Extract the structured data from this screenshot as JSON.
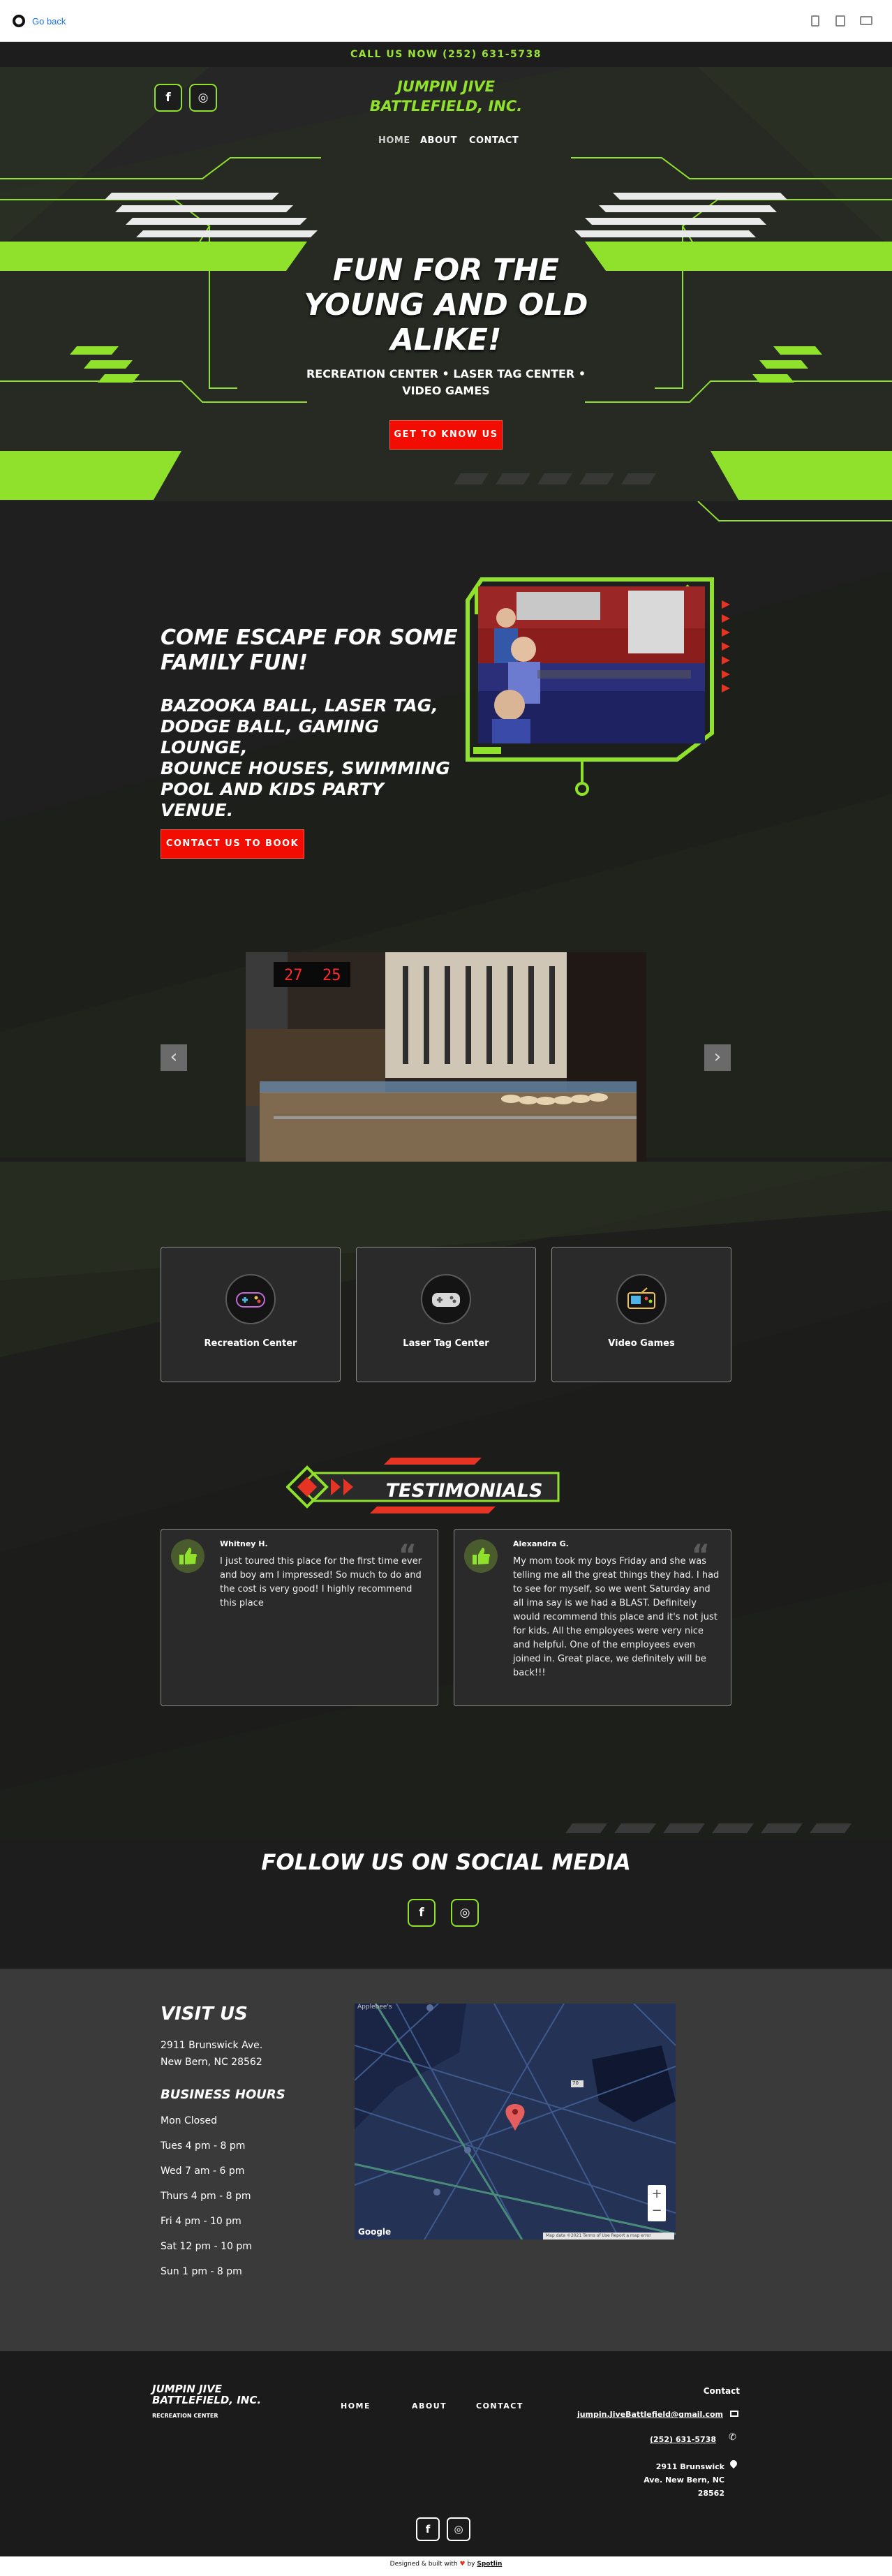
{
  "browser": {
    "go_back": "Go back"
  },
  "callbar": {
    "text": "CALL US NOW (252) 631-5738"
  },
  "header": {
    "logo_line1": "JUMPIN JIVE",
    "logo_line2": "BATTLEFIELD, INC.",
    "social": {
      "facebook": "f",
      "instagram": "◎"
    },
    "nav": {
      "home": "HOME",
      "about": "ABOUT",
      "contact": "CONTACT"
    }
  },
  "hero": {
    "title_l1": "FUN FOR THE",
    "title_l2": "YOUNG AND OLD",
    "title_l3": "ALIKE!",
    "sub_l1": "RECREATION CENTER • LASER TAG CENTER •",
    "sub_l2": "VIDEO GAMES",
    "button": "GET TO KNOW US"
  },
  "escape": {
    "title_l1": "COME ESCAPE FOR SOME",
    "title_l2": "FAMILY FUN!",
    "list_l1": "BAZOOKA BALL, LASER TAG,",
    "list_l2": "DODGE BALL, GAMING LOUNGE,",
    "list_l3": "BOUNCE HOUSES, SWIMMING",
    "list_l4": "POOL AND KIDS PARTY VENUE.",
    "button": "CONTACT US TO BOOK"
  },
  "gallery": {
    "prev": "‹",
    "next": "›",
    "score_left": "27",
    "score_right": "25"
  },
  "services": [
    {
      "label": "Recreation Center"
    },
    {
      "label": "Laser Tag Center"
    },
    {
      "label": "Video Games"
    }
  ],
  "testimonials": {
    "heading": "TESTIMONIALS",
    "items": [
      {
        "name": "Whitney H.",
        "text": "I just toured this place for the first time ever and boy am I impressed! So much to do and the cost is very good! I highly recommend this place"
      },
      {
        "name": "Alexandra G.",
        "text": "My mom took my boys Friday and she was telling me all the great things they had. I had to see for myself, so we went Saturday and all ima say is we had a BLAST. Definitely would recommend this place and it's not just for kids. All the employees were very nice and helpful. One of the employees even joined in. Great place, we definitely will be back!!!"
      }
    ]
  },
  "follow": {
    "heading": "FOLLOW US ON SOCIAL MEDIA"
  },
  "visit": {
    "heading": "VISIT US",
    "address_l1": "2911 Brunswick Ave.",
    "address_l2": "New Bern, NC 28562",
    "hours_heading": "BUSINESS HOURS",
    "hours": [
      "Mon Closed",
      "Tues 4 pm - 8 pm",
      "Wed 7 am - 6 pm",
      "Thurs 4 pm - 8 pm",
      "Fri 4 pm - 10 pm",
      "Sat 12 pm - 10 pm",
      "Sun 1 pm - 8 pm"
    ],
    "map": {
      "zoom_in": "+",
      "zoom_out": "−",
      "brand": "Google",
      "label1": "Applebee's",
      "label2": "70",
      "label3": "Map data ©2021  Terms of Use  Report a map error"
    }
  },
  "footer": {
    "logo_l1": "JUMPIN JIVE",
    "logo_l2": "BATTLEFIELD, INC.",
    "logo_sub": "RECREATION CENTER",
    "nav": {
      "home": "HOME",
      "about": "ABOUT",
      "contact": "CONTACT"
    },
    "contact_heading": "Contact",
    "email": "jumpin.JiveBattlefield@gmail.com",
    "phone": "(252) 631-5738",
    "addr_l1": "2911 Brunswick",
    "addr_l2": "Ave. New Bern, NC",
    "addr_l3": "28562",
    "credit_prefix": "Designed & built with",
    "credit_by": "by",
    "credit_brand": "Spotlin"
  },
  "colors": {
    "accent_green": "#8fe12b",
    "accent_red": "#f20d00",
    "bg_dark": "#1d1d1d"
  }
}
